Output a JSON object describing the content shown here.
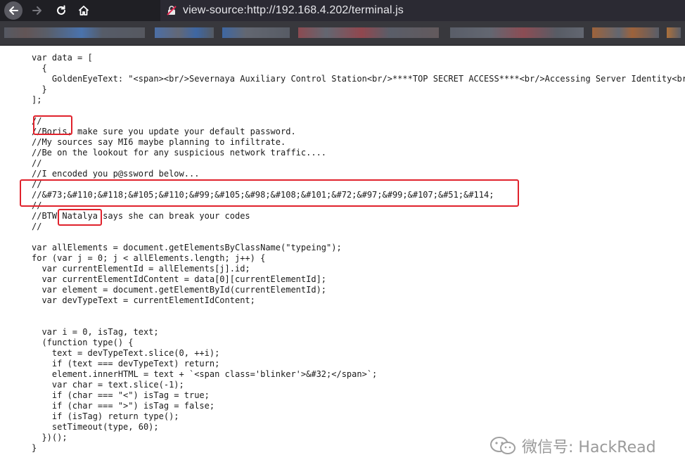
{
  "browser": {
    "url": "view-source:http://192.168.4.202/terminal.js",
    "colors": {
      "chrome": "#1f1f24",
      "urlbar": "#2b2a33",
      "bookmarks": "#38383d"
    }
  },
  "source": {
    "lines": [
      "var data = [",
      "  {",
      "    GoldenEyeText: \"<span><br/>Severnaya Auxiliary Control Station<br/>****TOP SECRET ACCESS****<br/>Accessing Server Identity<br/>",
      "  }",
      "];",
      "",
      "//",
      "//Boris, make sure you update your default password.",
      "//My sources say MI6 maybe planning to infiltrate.",
      "//Be on the lookout for any suspicious network traffic....",
      "//",
      "//I encoded you p@ssword below...",
      "//",
      "//&#73;&#110;&#118;&#105;&#110;&#99;&#105;&#98;&#108;&#101;&#72;&#97;&#99;&#107;&#51;&#114;",
      "//",
      "//BTW Natalya says she can break your codes",
      "//",
      "",
      "var allElements = document.getElementsByClassName(\"typeing\");",
      "for (var j = 0; j < allElements.length; j++) {",
      "  var currentElementId = allElements[j].id;",
      "  var currentElementIdContent = data[0][currentElementId];",
      "  var element = document.getElementById(currentElementId);",
      "  var devTypeText = currentElementIdContent;",
      "",
      "",
      "  var i = 0, isTag, text;",
      "  (function type() {",
      "    text = devTypeText.slice(0, ++i);",
      "    if (text === devTypeText) return;",
      "    element.innerHTML = text + `<span class='blinker'>&#32;</span>`;",
      "    var char = text.slice(-1);",
      "    if (char === \"<\") isTag = true;",
      "    if (char === \">\") isTag = false;",
      "    if (isTag) return type();",
      "    setTimeout(type, 60);",
      "  })();",
      "}"
    ]
  },
  "watermark": {
    "text": "微信号: HackRead",
    "icon": "wechat-icon"
  },
  "highlight_color": "#e0222c"
}
